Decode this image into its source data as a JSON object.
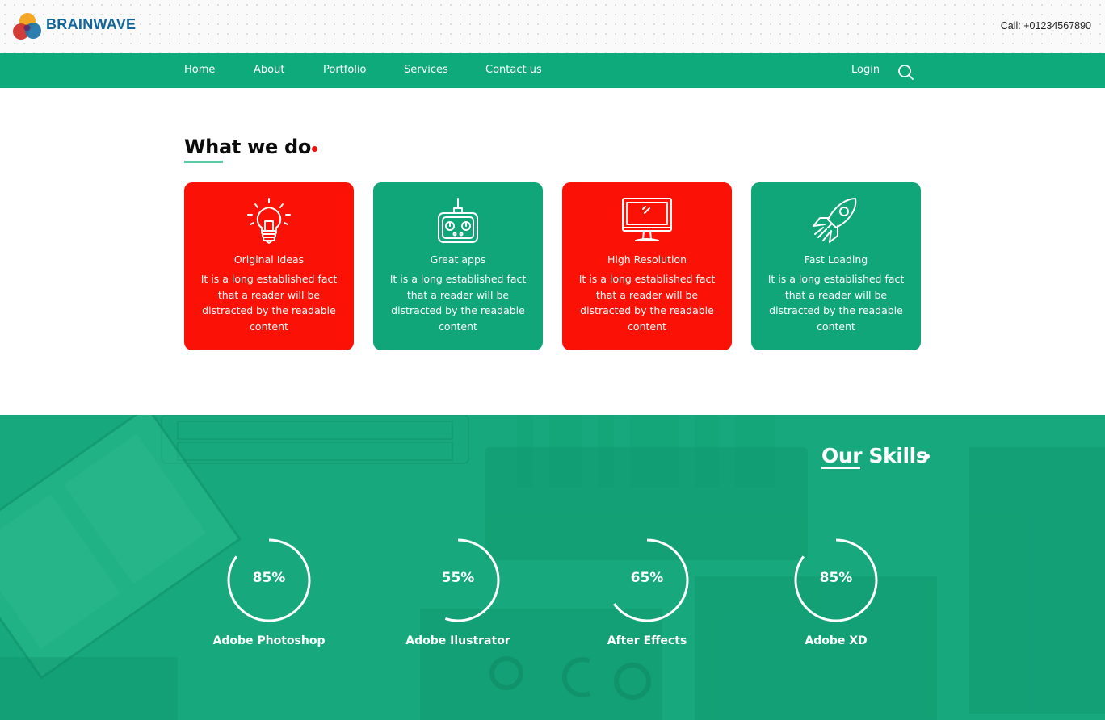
{
  "brand": {
    "name": "BRAINWAVE"
  },
  "header": {
    "call": "Call: +01234567890"
  },
  "nav": {
    "items": [
      {
        "label": "Home"
      },
      {
        "label": "About"
      },
      {
        "label": "Portfolio"
      },
      {
        "label": "Services"
      },
      {
        "label": "Contact us"
      }
    ],
    "login": "Login",
    "search_icon": "search-icon"
  },
  "what_we_do": {
    "title": "What we do",
    "cards": [
      {
        "icon": "lightbulb-icon",
        "title": "Original Ideas",
        "text": "It is a long established fact that a reader will be distracted by the readable content",
        "color": "#fb1106"
      },
      {
        "icon": "remote-control-icon",
        "title": "Great apps",
        "text": "It is a long established fact that a reader will be distracted by the readable content",
        "color": "#10a67a"
      },
      {
        "icon": "monitor-icon",
        "title": "High Resolution",
        "text": "It is a long established fact that a reader will be distracted by the readable content",
        "color": "#fb1106"
      },
      {
        "icon": "rocket-icon",
        "title": "Fast Loading",
        "text": "It is a long established fact that a reader will be distracted by the readable content",
        "color": "#10a67a"
      }
    ]
  },
  "skills": {
    "title": "Our Skills",
    "items": [
      {
        "percent_label": "85%",
        "percent": 85,
        "name": "Adobe Photoshop"
      },
      {
        "percent_label": "55%",
        "percent": 55,
        "name": "Adobe Ilustrator"
      },
      {
        "percent_label": "65%",
        "percent": 65,
        "name": "After Effects"
      },
      {
        "percent_label": "85%",
        "percent": 85,
        "name": "Adobe XD"
      }
    ]
  },
  "colors": {
    "accent_green": "#0eaa7c",
    "accent_red": "#fb1106",
    "brand_blue": "#11669a"
  }
}
